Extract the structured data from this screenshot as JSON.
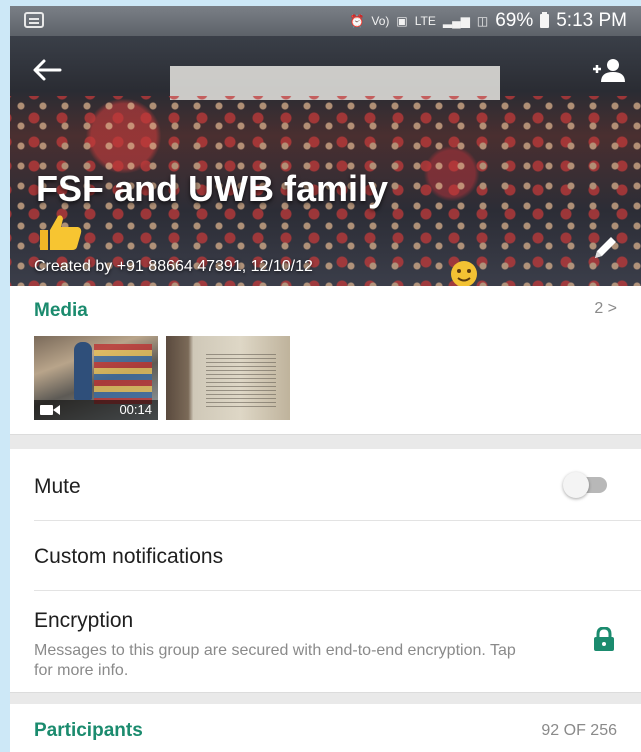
{
  "status_bar": {
    "network_labels": [
      "Vo)",
      "LTE",
      "LTE"
    ],
    "battery": "69%",
    "time": "5:13 PM"
  },
  "header": {
    "group_name": "FSF and UWB family",
    "created_by": "Created by +91 88664 47391, 12/10/12",
    "icons": [
      "back-arrow-icon",
      "add-participant-icon",
      "edit-icon",
      "thumbs-up-emoji",
      "smile-emoji"
    ]
  },
  "media": {
    "label": "Media",
    "count": "2 >",
    "video_duration": "00:14"
  },
  "settings": {
    "mute_label": "Mute",
    "mute_on": false,
    "custom_notifications_label": "Custom notifications",
    "encryption_label": "Encryption",
    "encryption_desc": "Messages to this group are secured with end-to-end encryption. Tap for more info."
  },
  "participants": {
    "label": "Participants",
    "count": "92 OF 256"
  },
  "colors": {
    "accent": "#1b8b6e",
    "secondary_text": "#8a8a8a",
    "status_bar": "#6b7077"
  }
}
